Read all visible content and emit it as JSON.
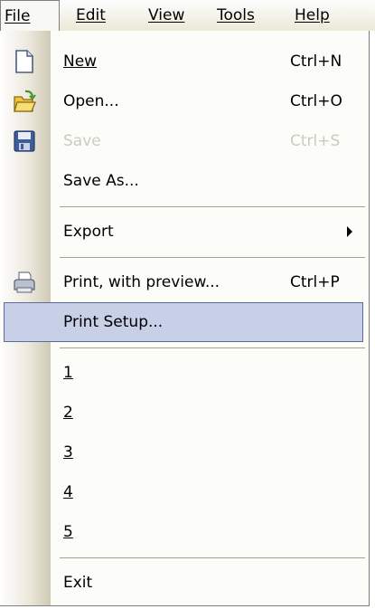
{
  "menubar": {
    "file": "File",
    "edit": "Edit",
    "view": "View",
    "tools": "Tools",
    "help": "Help"
  },
  "menu": {
    "new": {
      "label": "New",
      "shortcut": "Ctrl+N",
      "icon": "new-document-icon"
    },
    "open": {
      "label": "Open...",
      "shortcut": "Ctrl+O",
      "icon": "open-folder-icon"
    },
    "save": {
      "label": "Save",
      "shortcut": "Ctrl+S",
      "icon": "floppy-disk-icon",
      "disabled": true
    },
    "save_as": {
      "label": "Save As..."
    },
    "export": {
      "label": "Export"
    },
    "print_preview": {
      "label": "Print, with preview...",
      "shortcut": "Ctrl+P",
      "icon": "printer-icon"
    },
    "print_setup": {
      "label": "Print Setup...",
      "highlighted": true
    },
    "recent": [
      "1",
      "2",
      "3",
      "4",
      "5"
    ],
    "exit": {
      "label": "Exit"
    }
  },
  "colors": {
    "highlight_fill": "#c7d0e7",
    "highlight_border": "#646a96",
    "disabled_text": "#cdcac0"
  }
}
